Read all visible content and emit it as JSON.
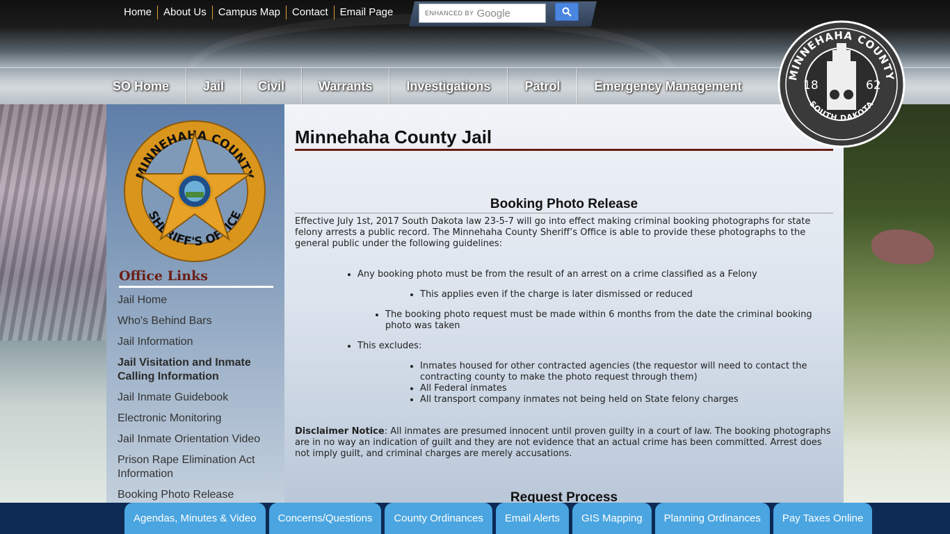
{
  "top_links": [
    "Home",
    "About Us",
    "Campus Map",
    "Contact",
    "Email Page"
  ],
  "search": {
    "enhanced_label": "ENHANCED BY",
    "brand": "Google",
    "button_icon": "search-icon"
  },
  "main_nav": [
    "SO Home",
    "Jail",
    "Civil",
    "Warrants",
    "Investigations",
    "Patrol",
    "Emergency Management"
  ],
  "seal": {
    "top_text": "MINNEHAHA COUNTY",
    "bottom_text": "SOUTH DAKOTA",
    "year_left": "18",
    "year_right": "62"
  },
  "badge": {
    "top_text": "MINNEHAHA COUNTY",
    "bottom_text": "SHERIFF'S OFFICE"
  },
  "sidebar": {
    "title": "Office Links",
    "items": [
      {
        "label": "Jail Home",
        "active": false
      },
      {
        "label": "Who's Behind Bars",
        "active": false
      },
      {
        "label": "Jail Information",
        "active": false
      },
      {
        "label": "Jail Visitation and Inmate Calling Information",
        "active": true
      },
      {
        "label": "Jail Inmate Guidebook",
        "active": false
      },
      {
        "label": "Electronic Monitoring",
        "active": false
      },
      {
        "label": "Jail Inmate Orientation Video",
        "active": false
      },
      {
        "label": "Prison Rape Elimination Act Information",
        "active": false
      },
      {
        "label": "Booking Photo Release",
        "active": false
      }
    ]
  },
  "content": {
    "page_title": "Minnehaha County Jail",
    "section_heading": "Booking Photo Release",
    "intro": "Effective July 1st, 2017 South Dakota law 23-5-7 will go into effect making criminal booking photographs for state felony arrests a public record. The Minnehaha County Sheriff’s Office is able to provide these photographs to the general public under the following guidelines:",
    "bullet1": "Any booking photo must be from the result of an arrest on a crime classified as a Felony",
    "bullet1_sub": "This applies even if the charge is later dismissed or reduced",
    "bullet2": "The booking photo request must be made within 6 months from the date the criminal booking photo was taken",
    "bullet3": "This excludes:",
    "excludes": [
      "Inmates housed for other contracted agencies (the requestor will need to contact the contracting county to make the photo request through them)",
      "All Federal inmates",
      "All transport company inmates not being held on State felony charges"
    ],
    "disclaimer_label": "Disclaimer Notice",
    "disclaimer_text": ":  All inmates are presumed innocent until proven guilty in a court of law.  The booking photographs are in no way an indication of guilt and they are not evidence that an actual crime has been committed.  Arrest does not imply guilt, and criminal charges are merely accusations.",
    "request_heading": "Request Process"
  },
  "bottom_bar": [
    "Agendas, Minutes & Video",
    "Concerns/Questions",
    "County Ordinances",
    "Email Alerts",
    "GIS Mapping",
    "Planning Ordinances",
    "Pay Taxes Online"
  ],
  "colors": {
    "accent_maroon": "#6b1e14",
    "bottom_bar_bg": "#0d2a55",
    "bottom_button": "#4aa5e0",
    "badge_gold": "#d9951c"
  }
}
